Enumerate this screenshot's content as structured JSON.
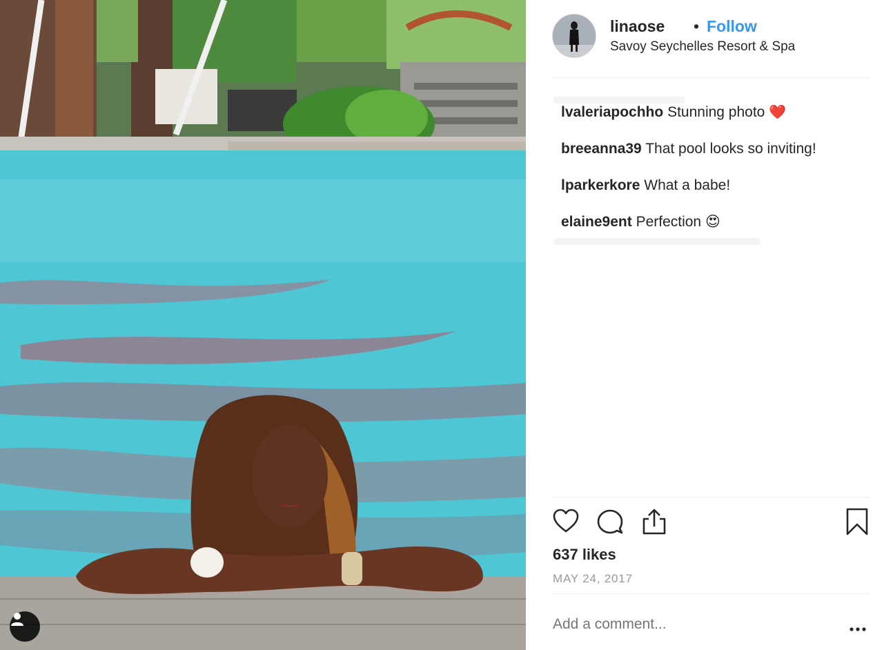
{
  "post": {
    "username": "linaose",
    "separator": "•",
    "follow_label": "Follow",
    "location": "Savoy Seychelles Resort & Spa",
    "comments": [
      {
        "user": "lvaleriapochho",
        "text": "Stunning photo",
        "emoji": "❤️"
      },
      {
        "user": "breeanna39",
        "text": "That pool looks so inviting!",
        "emoji": ""
      },
      {
        "user": "lparkerkore",
        "text": "What a babe!",
        "emoji": ""
      },
      {
        "user": "elaine9ent",
        "text": "Perfection",
        "emoji": "😍"
      }
    ],
    "likes": "637 likes",
    "date": "MAY 24, 2017",
    "add_comment_placeholder": "Add a comment..."
  },
  "icons": {
    "like": "heart-icon",
    "comment": "speech-bubble-icon",
    "share": "share-icon",
    "save": "bookmark-icon",
    "more": "ellipsis-icon",
    "user_tag": "user-icon"
  },
  "colors": {
    "follow_blue": "#3897f0",
    "text": "#262626",
    "muted": "#8e8e8e"
  }
}
